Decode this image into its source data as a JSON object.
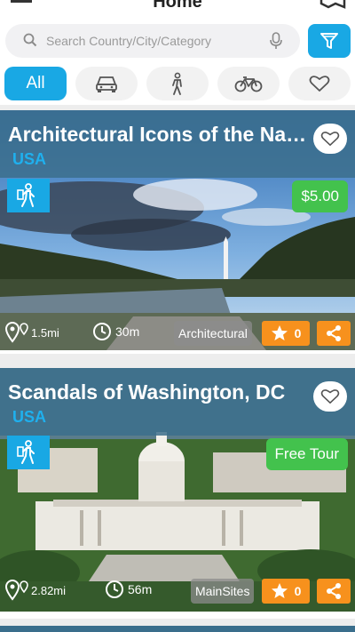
{
  "header": {
    "title": "Home",
    "menu_icon": "hamburger-menu-icon",
    "map_icon": "map-icon"
  },
  "search": {
    "placeholder": "Search Country/City/Category",
    "value": "",
    "icon": "search-icon",
    "mic_icon": "microphone-icon"
  },
  "filter": {
    "icon": "filter-icon",
    "color": "#19a8e4"
  },
  "categories": [
    {
      "label": "All",
      "active": true
    },
    {
      "label": "",
      "icon": "car-icon"
    },
    {
      "label": "",
      "icon": "walking-person-icon"
    },
    {
      "label": "",
      "icon": "bicycle-icon"
    },
    {
      "label": "",
      "icon": "heart-icon"
    }
  ],
  "tours": [
    {
      "title": "Architectural Icons of the Nati...",
      "country": "USA",
      "price": "$5.00",
      "price_color": "#43c24d",
      "distance": "1.5mi",
      "duration": "30m",
      "category": "Architectural",
      "rating": "0",
      "type_icon": "hiking-person-icon"
    },
    {
      "title": "Scandals of Washington, DC",
      "country": "USA",
      "price": "Free Tour",
      "price_color": "#43c24d",
      "distance": "2.82mi",
      "duration": "56m",
      "category": "MainSites",
      "rating": "0",
      "type_icon": "hiking-person-icon"
    }
  ],
  "colors": {
    "accent": "#19a8e4",
    "orange": "#f7911d",
    "green": "#43c24d"
  }
}
